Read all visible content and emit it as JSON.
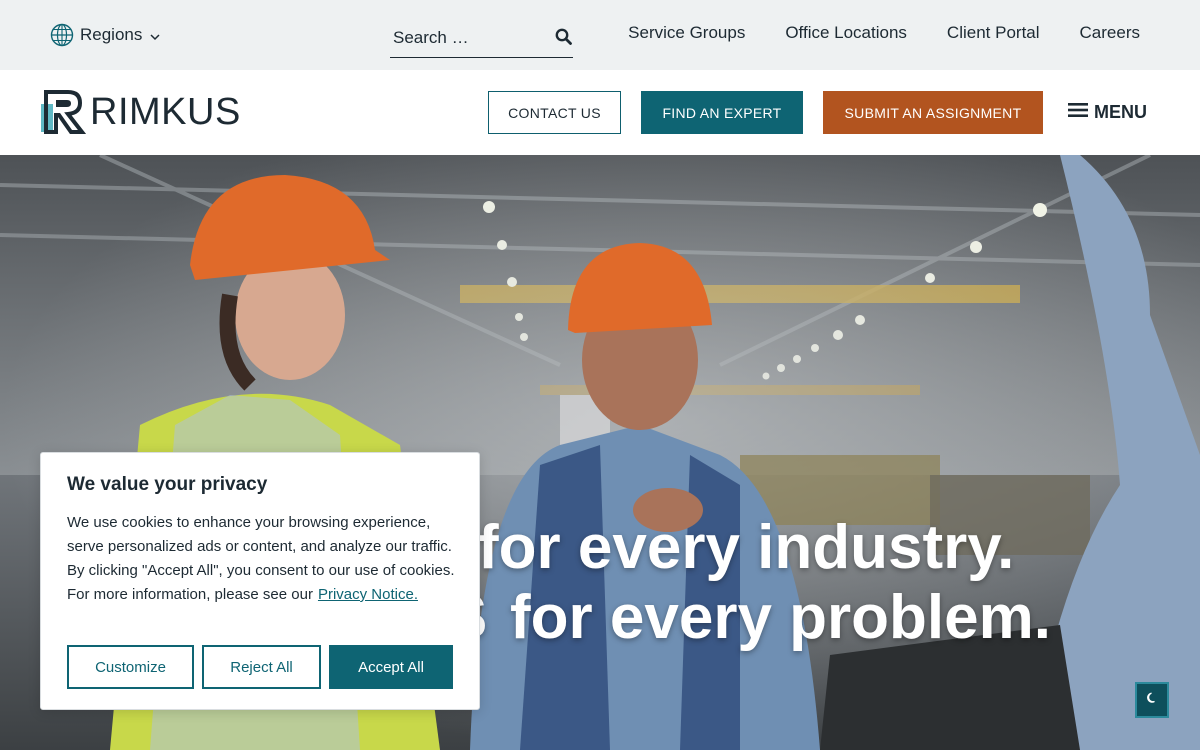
{
  "topbar": {
    "regions_label": "Regions",
    "search_placeholder": "Search …",
    "links": [
      "Service Groups",
      "Office Locations",
      "Client Portal",
      "Careers"
    ]
  },
  "header": {
    "logo_text": "RIMKUS",
    "contact_label": "CONTACT US",
    "expert_label": "FIND AN EXPERT",
    "assign_label": "SUBMIT AN ASSIGNMENT",
    "menu_label": "MENU"
  },
  "hero": {
    "line1": "for every industry.",
    "line2_prefix": "S",
    "line2": "for every problem."
  },
  "cookie": {
    "title": "We value your privacy",
    "body": "We use cookies to enhance your browsing experience, serve personalized ads or content, and analyze our traffic. By clicking \"Accept All\", you consent to our use of cookies. For more information, please see our",
    "privacy_link": "Privacy Notice.",
    "customize_label": "Customize",
    "reject_label": "Reject All",
    "accept_label": "Accept All"
  },
  "colors": {
    "teal": "#0e6473",
    "orange": "#b2541f",
    "topbar_bg": "#eef1f2",
    "text": "#1d2a33"
  },
  "icons": [
    "globe-icon",
    "chevron-down-icon",
    "search-icon",
    "hamburger-icon",
    "moon-icon"
  ]
}
